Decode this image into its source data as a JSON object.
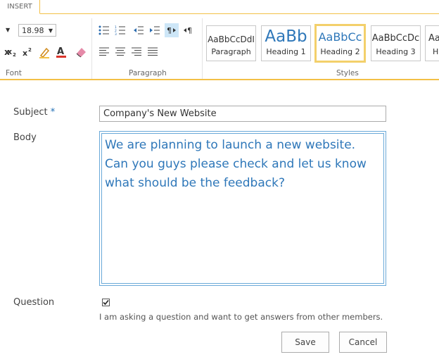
{
  "ribbon": {
    "tab_label": "INSERT",
    "font_group_label": "Font",
    "paragraph_group_label": "Paragraph",
    "styles_group_label": "Styles",
    "font_size": "18.98",
    "styles": [
      {
        "sample": "AaBbCcDdI",
        "name": "Paragraph"
      },
      {
        "sample": "AaBb",
        "name": "Heading 1"
      },
      {
        "sample": "AaBbCc",
        "name": "Heading 2"
      },
      {
        "sample": "AaBbCcDc",
        "name": "Heading 3"
      },
      {
        "sample": "Aa",
        "name": "H"
      }
    ],
    "active_style": "Heading 2",
    "accent_color": "#f3c046"
  },
  "form": {
    "subject_label": "Subject",
    "required_marker": "*",
    "subject_value": "Company's New Website",
    "body_label": "Body",
    "body_value": "We are planning to launch a new website. Can you guys please check and let us know what should be the feedback?",
    "question_label": "Question",
    "question_checked": true,
    "question_hint": "I am asking a question and want to get answers from other members.",
    "save_label": "Save",
    "cancel_label": "Cancel"
  }
}
